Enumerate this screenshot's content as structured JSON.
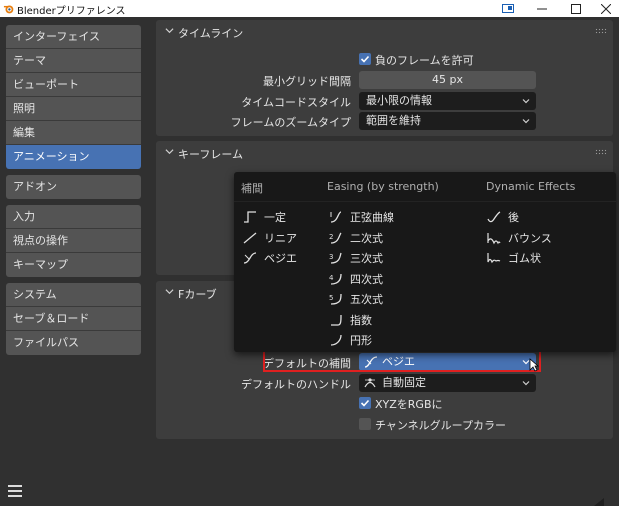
{
  "window": {
    "title": "Blenderプリファレンス",
    "icons": {
      "app": "blender-logo-icon",
      "extra": "window-layout-icon",
      "minimize": "minimize-icon",
      "maximize": "maximize-icon",
      "close": "close-icon"
    }
  },
  "sidebar": {
    "groups": [
      [
        "インターフェイス",
        "テーマ",
        "ビューポート",
        "照明",
        "編集",
        "アニメーション"
      ],
      [
        "アドオン"
      ],
      [
        "入力",
        "視点の操作",
        "キーマップ"
      ],
      [
        "システム",
        "セーブ＆ロード",
        "ファイルパス"
      ]
    ],
    "active": "アニメーション"
  },
  "timeline": {
    "title": "タイムライン",
    "allow_negative": {
      "label": "負のフレームを許可",
      "checked": true
    },
    "min_grid": {
      "label": "最小グリッド間隔",
      "value": "45 px"
    },
    "timecode": {
      "label": "タイムコードスタイル",
      "value": "最小限の情報"
    },
    "zoom": {
      "label": "フレームのズームタイプ",
      "value": "範囲を維持"
    }
  },
  "keyframes": {
    "title": "キーフレーム"
  },
  "fcurves": {
    "title": "Fカーブ",
    "default_interp": {
      "label": "デフォルトの補間",
      "value": "ベジエ"
    },
    "default_handle": {
      "label": "デフォルトのハンドル",
      "value": "自動固定"
    },
    "xyz_rgb": {
      "label": "XYZをRGBに",
      "checked": true
    },
    "channel_color": {
      "label": "チャンネルグループカラー",
      "checked": false
    }
  },
  "popup": {
    "headers": {
      "interp": "補間",
      "easing": "Easing (by strength)",
      "dynamic": "Dynamic Effects"
    },
    "interp_items": [
      {
        "label": "一定",
        "icon": "constant-interp-icon"
      },
      {
        "label": "リニア",
        "icon": "linear-interp-icon"
      },
      {
        "label": "ベジエ",
        "icon": "bezier-interp-icon"
      }
    ],
    "easing_items": [
      {
        "label": "正弦曲線",
        "icon": "sine-ease-icon"
      },
      {
        "label": "二次式",
        "icon": "quadratic-ease-icon"
      },
      {
        "label": "三次式",
        "icon": "cubic-ease-icon"
      },
      {
        "label": "四次式",
        "icon": "quartic-ease-icon"
      },
      {
        "label": "五次式",
        "icon": "quintic-ease-icon"
      },
      {
        "label": "指数",
        "icon": "exponential-ease-icon"
      },
      {
        "label": "円形",
        "icon": "circular-ease-icon"
      }
    ],
    "dynamic_items": [
      {
        "label": "後",
        "icon": "back-ease-icon"
      },
      {
        "label": "バウンス",
        "icon": "bounce-ease-icon"
      },
      {
        "label": "ゴム状",
        "icon": "elastic-ease-icon"
      }
    ]
  },
  "colors": {
    "accent": "#4772b3",
    "highlight": "#e02020"
  }
}
